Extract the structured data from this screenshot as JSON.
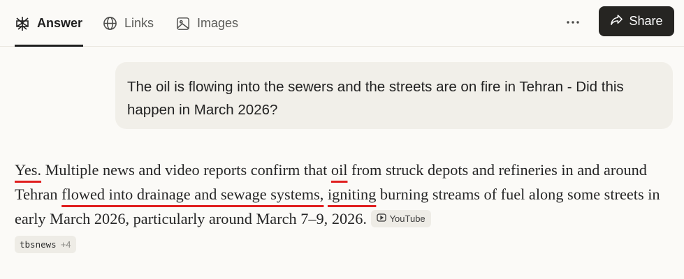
{
  "tabs": [
    {
      "label": "Answer",
      "icon": "perplexity-logo-icon",
      "active": true
    },
    {
      "label": "Links",
      "icon": "globe-icon",
      "active": false
    },
    {
      "label": "Images",
      "icon": "image-icon",
      "active": false
    }
  ],
  "header": {
    "more_icon": "ellipsis-icon",
    "share_label": "Share",
    "share_icon": "share-arrow-icon"
  },
  "query": {
    "text": "The oil is flowing into the sewers and the streets are on fire in Tehran - Did this happen in March 2026?"
  },
  "answer": {
    "seg1": "Yes.",
    "seg2": " Multiple news and video reports confirm that ",
    "seg3": "oil",
    "seg4": " from struck depots and refineries in and around Tehran ",
    "seg5": "flowed into drainage and sewage systems,",
    "seg6": " ",
    "seg7": "igniting",
    "seg8": " burning streams of fuel along some streets in early March 2026, particularly around March 7–9, 2026.",
    "underline_color": "#e01e1e"
  },
  "sources": [
    {
      "label": "YouTube",
      "icon": "youtube-icon"
    },
    {
      "label": "tbsnews",
      "extra": "+4"
    }
  ],
  "colors": {
    "background": "#fbfaf7",
    "share_bg": "#262522",
    "bubble_bg": "#f1efe9"
  }
}
